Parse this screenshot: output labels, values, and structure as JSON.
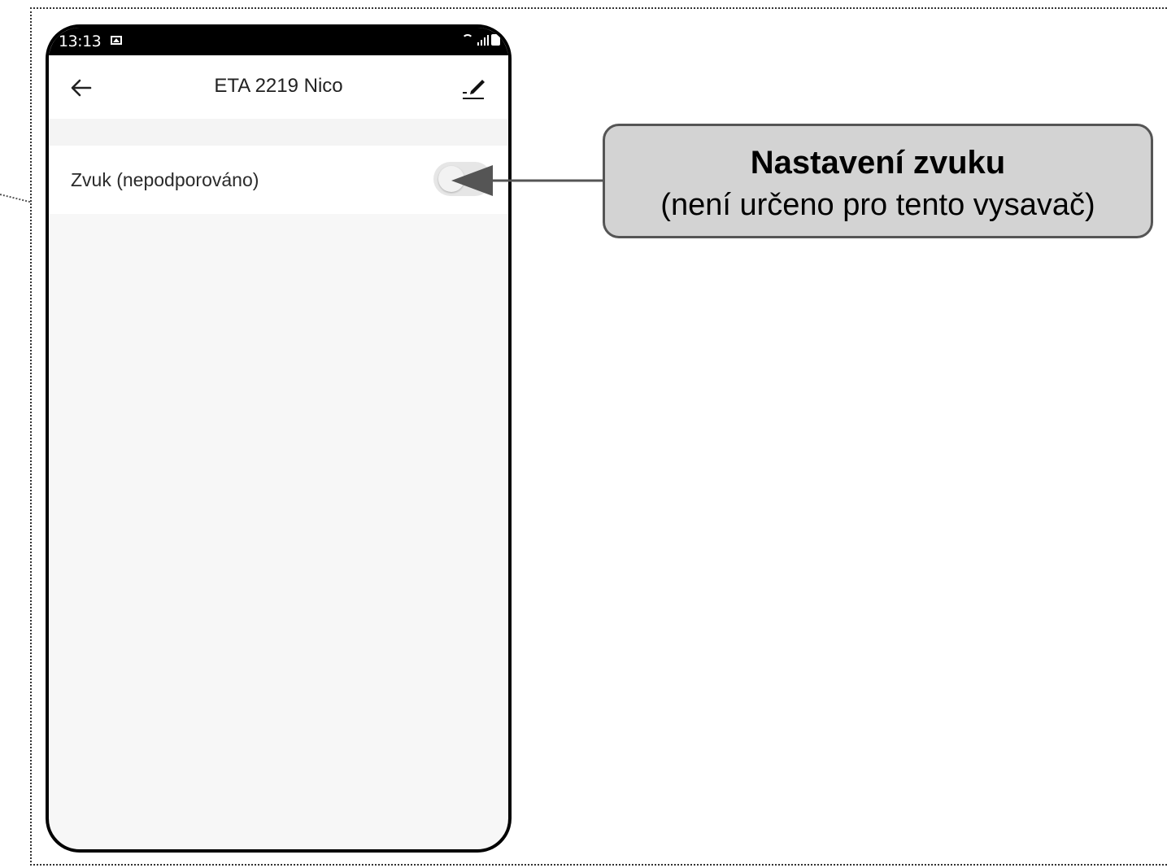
{
  "status_bar": {
    "time": "13:13",
    "icons": [
      "image-icon",
      "wifi-icon",
      "signal-icon",
      "battery-icon"
    ]
  },
  "app_bar": {
    "title": "ETA 2219 Nico",
    "back_icon": "arrow-left-icon",
    "edit_icon": "pencil-underline-icon"
  },
  "settings": {
    "items": [
      {
        "label": "Zvuk (nepodporováno)",
        "toggle_state": "off"
      }
    ]
  },
  "callout": {
    "title": "Nastavení zvuku",
    "subtitle": "(není určeno pro tento vysavač)"
  },
  "colors": {
    "callout_bg": "#d3d3d3",
    "callout_border": "#555555",
    "phone_bg": "#f7f7f7",
    "toggle_track": "#e6e6e6"
  }
}
